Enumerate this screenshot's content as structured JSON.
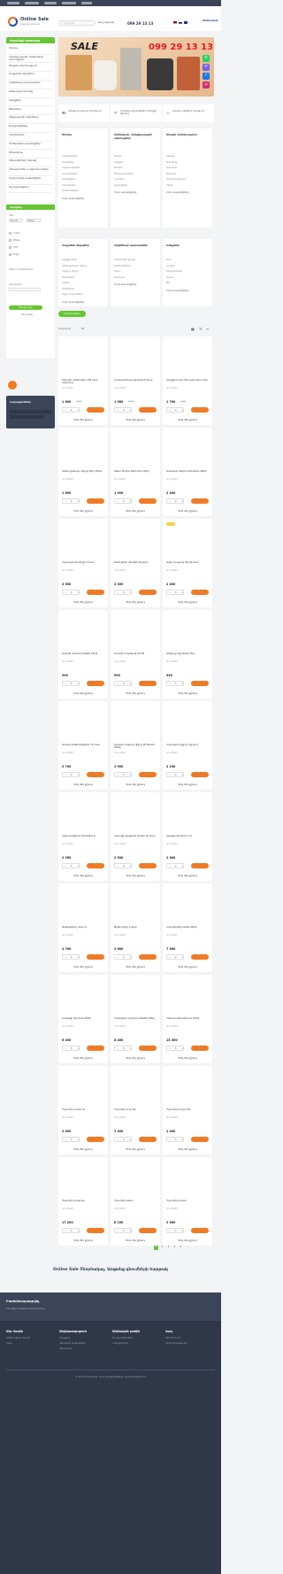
{
  "brand": {
    "name": "Online Sale",
    "subtitle": "Առցանց խանութ"
  },
  "header": {
    "search_placeholder": "Որոնում",
    "categories_label": "Ճաշացանկ",
    "phone": "099 29 13 13",
    "cabinet_label": "Անձնական"
  },
  "hero": {
    "sale_text": "SALE",
    "phone": "099 29 13 13"
  },
  "sidebar": {
    "title": "Ապրանքի կատալոգ",
    "items": [
      "Սնունդ",
      "Կոնցելյարային, Գրենական պիտույքներ",
      "Տնային տնտեսություն",
      "Մաքրման միջոցներ",
      "Հիգիենայի պարագաներ",
      "Անձնական խնամք",
      "Խմիչքներ",
      "Տեխնիկա",
      "Կենցաղային տեխնիկա",
      "Քաղցրավենիք",
      "Կոսմետիկա",
      "Մանկական ապրանքներ",
      "Շինանյութ",
      "Կենդանիների խնամք",
      "Հեռախոսներ և աքսեսուարներ",
      "Սպորտային ապրանքներ",
      "Այլ ապրանքներ"
    ]
  },
  "filter": {
    "title": "Զտիչներ",
    "price_label": "Գին",
    "from_label": "Սկսած",
    "to_label": "Մինչև",
    "options": [
      "Ուժեղ",
      "Թեթև",
      "Մեծ",
      "Փոքր"
    ],
    "in_stock_label": "Առկա է պահեստում",
    "brand_label": "Արտադրող",
    "apply_label": "Ցույց տալ",
    "reset_label": "Չեղարկել"
  },
  "benefits": [
    "Առաքում ամբողջ Երևանում",
    "Որակյալ ապրանքներ մատչելի գներով",
    "Արագ և անվճար առաքում"
  ],
  "boxes": [
    {
      "title": "Սնունդ",
      "links": [
        "Կաթնամթերք",
        "Մսամթերք",
        "Հացաբուլկեղեն",
        "Հրուշակեղեն",
        "Ըմպելիքներ",
        "Պահածոներ",
        "Համեմունքներ"
      ],
      "more": "Բոլոր ապրանքները"
    },
    {
      "title": "Գրենական, Կանցելյարային պիտույքներ",
      "links": [
        "Թուղթ",
        "Գրիչներ",
        "Տետրեր",
        "Թղթապանակներ",
        "Նշումներ",
        "Կցորդիչներ"
      ],
      "more": "Բոլոր ապրանքները"
    },
    {
      "title": "Տնային տնտեսություն",
      "links": [
        "Սպասք",
        "Խոհանոց",
        "Լոգարան",
        "Տեքստիլ",
        "Պահեստավորում",
        "Դեկոր"
      ],
      "more": "Բոլոր ապրանքները"
    },
    {
      "title": "Մաքրման միջոցներ",
      "links": [
        "Լվացքի փոշի",
        "Աման լվանալու միջոց",
        "Մաքրող միջոց",
        "Սպունգներ",
        "Լաթեր",
        "Ձեռնոցներ",
        "Աղբի տոպրակներ"
      ],
      "more": "Բոլոր ապրանքները"
    },
    {
      "title": "Հիգիենայի պարագաներ",
      "links": [
        "Զուգարանի թուղթ",
        "Անձեռոցիկներ",
        "Օճառ",
        "Շամպուն"
      ],
      "more": "Բոլոր ապրանքները"
    },
    {
      "title": "Խմիչքներ",
      "links": [
        "Ջուր",
        "Հյութեր",
        "Գազավորված",
        "Սուրճ",
        "Թեյ"
      ],
      "more": "Բոլոր ապրանքները"
    }
  ],
  "listing": {
    "sort_label": "Սորտավորել",
    "show_label": "Ցուցադրել",
    "per_page": "12"
  },
  "news": {
    "title": "Նորություններ"
  },
  "product_defaults": {
    "meta": "Կոդ: 00123",
    "cart": "Գնել",
    "buy": "Գնել մեկ քլիկով"
  },
  "products": [
    {
      "name": "Սեղանի անձեռոցիկ 100 հատ սպիտակ",
      "price": "1 600",
      "old": "1 800"
    },
    {
      "name": "Զուգարանի թուղթ Zewa 8 հատ",
      "price": "1 980",
      "old": "2 200"
    },
    {
      "name": "Լվացքի փոշի Tide ավտոմատ 3կգ",
      "price": "1 700",
      "old": "1 900"
    },
    {
      "name": "Աման լվանալու միջոց Fairy 500մլ",
      "price": "1 890",
      "old": ""
    },
    {
      "name": "Օճառ հեղուկ Palmolive 300մլ",
      "price": "1 990",
      "old": ""
    },
    {
      "name": "Շամպուն Head & Shoulders 400մլ",
      "price": "2 400",
      "old": ""
    },
    {
      "name": "Սպունգ խոհանոցի 5 հատ",
      "price": "2 300",
      "old": ""
    },
    {
      "name": "Ձեռնոցներ ռետինե M չափս",
      "price": "2 300",
      "old": ""
    },
    {
      "name": "Աղբի տոպրակ 60լ 20 հատ",
      "price": "2 400",
      "old": ""
    },
    {
      "name": "Ատամի մածուկ Colgate 100մլ",
      "price": "990",
      "old": ""
    },
    {
      "name": "Ատամի խոզանակ Oral-B",
      "price": "990",
      "old": ""
    },
    {
      "name": "Ձեռքի քսուք Nivea 75մլ",
      "price": "990",
      "old": ""
    },
    {
      "name": "Խոնավ անձեռոցիկներ 72 հատ",
      "price": "2 700",
      "old": ""
    },
    {
      "name": "Ապակու մաքրող միջոց Mr Muscle 500մլ",
      "price": "2 900",
      "old": ""
    },
    {
      "name": "Հատակի մաքրող միջոց 1լ",
      "price": "2 100",
      "old": ""
    },
    {
      "name": "Սպիտակեցնող Domestos 1լ",
      "price": "2 350",
      "old": ""
    },
    {
      "name": "Սպասքի լվացման հաբեր 30 հատ",
      "price": "2 500",
      "old": ""
    },
    {
      "name": "Լվացքի գել Persil 1.5լ",
      "price": "2 600",
      "old": ""
    },
    {
      "name": "Փափկեցնող Lenor 1լ",
      "price": "4 700",
      "old": ""
    },
    {
      "name": "Թղթե սրբիչ 2 գլան",
      "price": "2 600",
      "old": ""
    },
    {
      "name": "Հոտազերծիչ Glade 300մլ",
      "price": "7 500",
      "old": ""
    },
    {
      "name": "Լոգանքի գել Dove 250մլ",
      "price": "6 400",
      "old": ""
    },
    {
      "name": "Սափրվելու փրփուր Gillette 200մլ",
      "price": "8 400",
      "old": ""
    },
    {
      "name": "Դեզոդորանտ Rexona 150մլ",
      "price": "15 300",
      "old": ""
    },
    {
      "name": "Պլաստիկ տարա 5լ",
      "price": "2 400",
      "old": ""
    },
    {
      "name": "Պլաստիկ դույլ 10լ",
      "price": "2 400",
      "old": ""
    },
    {
      "name": "Պլաստիկ տաշտ 20լ",
      "price": "2 400",
      "old": ""
    },
    {
      "name": "Պլաստիկ զամբյուղ",
      "price": "17 200",
      "old": ""
    },
    {
      "name": "Պլաստիկ աթոռ",
      "price": "8 100",
      "old": ""
    },
    {
      "name": "Պլաստիկ սեղան",
      "price": "2 500",
      "old": ""
    }
  ],
  "pager": [
    "1",
    "2",
    "3",
    "4",
    "5",
    "›"
  ],
  "slogan": "Online Sale Շնորհակալ. Առցանց գնումների հարթակ",
  "footer": {
    "subscribe_title": "Բաժանորդագրվել",
    "subscribe_sub": "Ստացեք առաջինը նորությունները",
    "cols": [
      {
        "title": "Մեր մասին",
        "items": [
          "Ընկերության մասին",
          "Կապ"
        ]
      },
      {
        "title": "Տեղեկատվություն",
        "items": [
          "Առաքում",
          "Վճարման եղանակներ",
          "Վերադարձ"
        ]
      },
      {
        "title": "Անձնական բաժին",
        "items": [
          "Իմ պատվերները",
          "Նախընտրելի"
        ]
      },
      {
        "title": "Կապ",
        "items": [
          "099 29 13 13",
          "info@onlinesale.am"
        ]
      }
    ],
    "copyright": "© 2024 Online Sale. Բոլոր իրավունքները պաշտպանված են"
  },
  "colors": {
    "green": "#66c533",
    "orange": "#f27a22",
    "navy": "#3b4458"
  }
}
